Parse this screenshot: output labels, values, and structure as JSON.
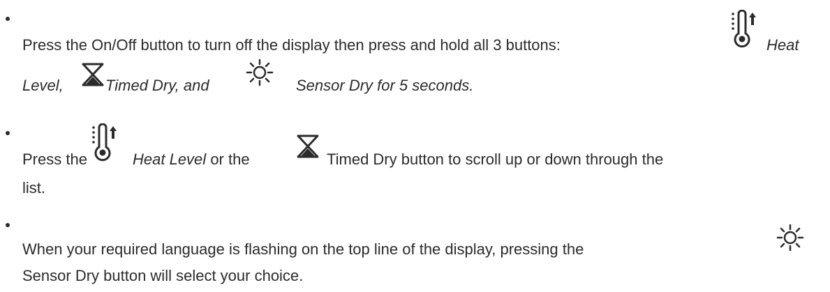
{
  "icons": {
    "heat_level": "thermometer-up-icon",
    "timed_dry": "hourglass-icon",
    "sensor_dry": "sun-icon"
  },
  "steps": [
    {
      "line1_text": "Press the On/Off button to turn off the display then press and hold all 3 buttons:",
      "line1_heat_label": "Heat",
      "line2_level": "Level,",
      "line2_timed": "Timed Dry, and",
      "line2_sensor": "Sensor Dry for 5 seconds."
    },
    {
      "line1_press": "Press the",
      "line1_heat_label": "Heat Level",
      "line1_or": "or the",
      "line1_timed": "Timed Dry button to scroll up or down through the",
      "line2": "list."
    },
    {
      "line1": "When your required language is flashing on the top line of the display, pressing the",
      "line2": "Sensor Dry button will select your choice."
    }
  ]
}
